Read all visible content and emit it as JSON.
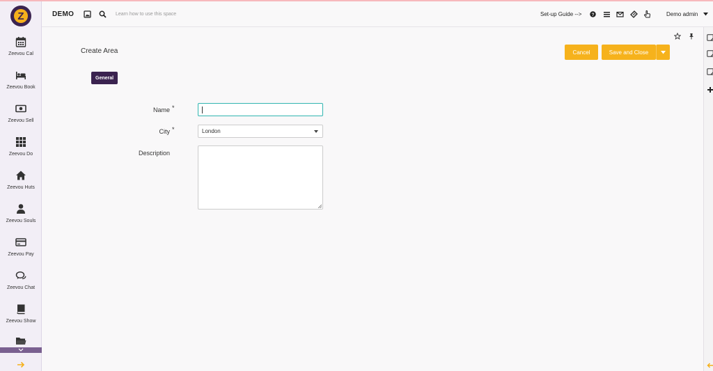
{
  "topbar": {
    "brand": "DEMO",
    "learn_text": "Learn how to use this space",
    "setup_guide": "Set-up Guide -->",
    "user_name": "Demo admin"
  },
  "sidebar": {
    "items": [
      {
        "label": "Zeevou Cal",
        "icon": "calendar-icon"
      },
      {
        "label": "Zeevou Book",
        "icon": "bed-icon"
      },
      {
        "label": "Zeevou Sell",
        "icon": "money-icon"
      },
      {
        "label": "Zeevou Do",
        "icon": "grid-icon"
      },
      {
        "label": "Zeevou Huts",
        "icon": "home-icon"
      },
      {
        "label": "Zeevou Souls",
        "icon": "user-icon"
      },
      {
        "label": "Zeevou Pay",
        "icon": "credit-card-icon"
      },
      {
        "label": "Zeevou Chat",
        "icon": "chat-icon"
      },
      {
        "label": "Zeevou Show",
        "icon": "book-icon"
      },
      {
        "label": "",
        "icon": "folder-icon"
      }
    ]
  },
  "page": {
    "title": "Create Area",
    "cancel": "Cancel",
    "save_close": "Save and Close",
    "tab_general": "General"
  },
  "form": {
    "name_label": "Name",
    "name_value": "",
    "required_mark": "*",
    "city_label": "City",
    "city_value": "London",
    "description_label": "Description",
    "description_value": ""
  },
  "colors": {
    "accent": "#f6b21c",
    "brand_dark": "#3b2350",
    "focus": "#30b5b0"
  }
}
